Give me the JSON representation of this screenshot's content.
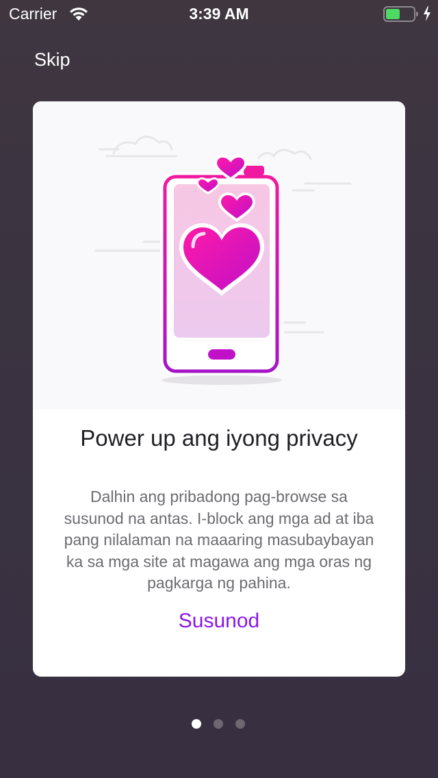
{
  "status_bar": {
    "carrier": "Carrier",
    "time": "3:39 AM",
    "battery_color": "#4cd964"
  },
  "skip_label": "Skip",
  "onboarding": {
    "title": "Power up ang iyong privacy",
    "body": "Dalhin ang pribadong pag-browse sa susunod na antas. I-block ang mga ad at iba pang nilalaman na maaaring masubaybayan ka sa mga site at magawa ang mga oras ng pagkarga ng pahina.",
    "next_label": "Susunod",
    "illustration_icon": "phone-hearts-illustration",
    "accent_color": "#8a18e6"
  },
  "page_indicator": {
    "count": 3,
    "current": 1
  }
}
